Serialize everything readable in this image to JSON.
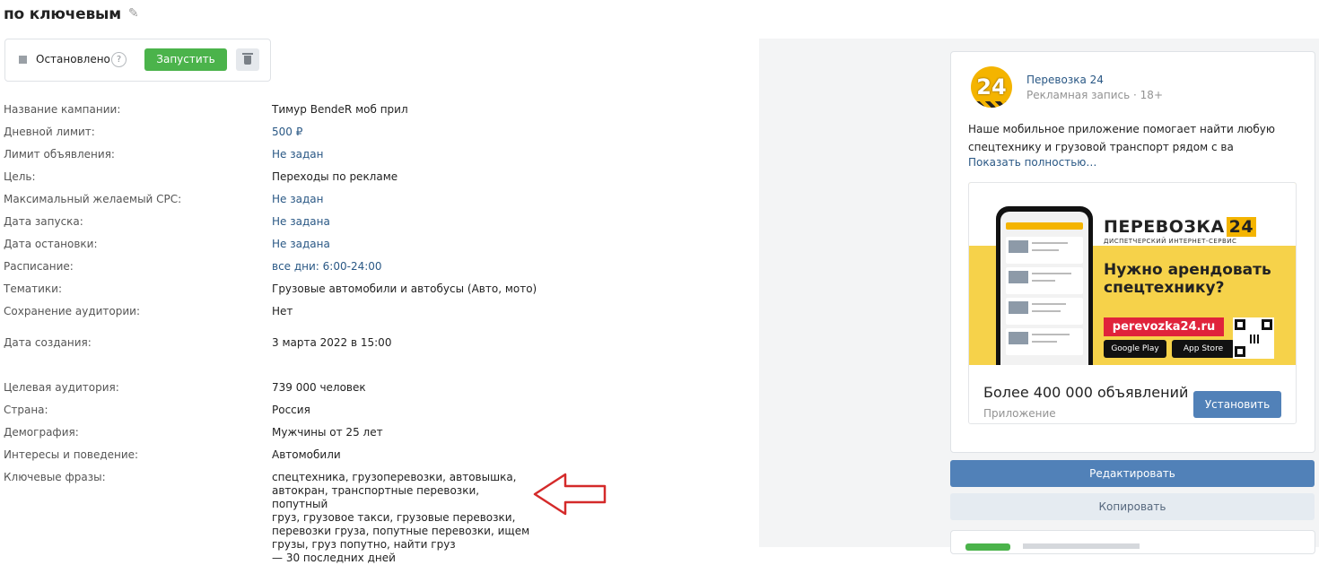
{
  "page": {
    "title": "по ключевым"
  },
  "status": {
    "text": "Остановлено",
    "help": "?",
    "run_label": "Запустить"
  },
  "fields": [
    {
      "label": "Название кампании:",
      "value": "Тимур BendeR моб прил",
      "link": false
    },
    {
      "label": "Дневной лимит:",
      "value": "500 ₽",
      "link": true
    },
    {
      "label": "Лимит объявления:",
      "value": "Не задан",
      "link": true
    },
    {
      "label": "Цель:",
      "value": "Переходы по рекламе",
      "link": false
    },
    {
      "label": "Максимальный желаемый CPC:",
      "value": "Не задан",
      "link": true
    },
    {
      "label": "Дата запуска:",
      "value": "Не задана",
      "link": true
    },
    {
      "label": "Дата остановки:",
      "value": "Не задана",
      "link": true
    },
    {
      "label": "Расписание:",
      "value": "все дни: 6:00-24:00",
      "link": true
    },
    {
      "label": "Тематики:",
      "value": "Грузовые автомобили и автобусы (Авто, мото)",
      "link": false
    },
    {
      "label": "Сохранение аудитории:",
      "value": "Нет",
      "link": false
    },
    {
      "label": "Дата создания:",
      "value": "3 марта 2022 в 15:00",
      "link": false
    },
    {
      "label": "Целевая аудитория:",
      "value": "739 000 человек",
      "link": false
    },
    {
      "label": "Страна:",
      "value": "Россия",
      "link": false
    },
    {
      "label": "Демография:",
      "value": "Мужчины от 25 лет",
      "link": false
    },
    {
      "label": "Интересы и поведение:",
      "value": "Автомобили",
      "link": false
    }
  ],
  "keywords": {
    "label": "Ключевые фразы:",
    "lines": [
      "спецтехника, грузоперевозки, автовышка,",
      "автокран, транспортные перевозки, попутный",
      "груз, грузовое такси, грузовые перевозки,",
      "перевозки груза, попутные перевозки, ищем",
      "грузы, груз попутно, найти груз",
      "— 30 последних дней"
    ]
  },
  "ad": {
    "name": "Перевозка 24",
    "sub": "Рекламная запись · 18+",
    "logo_text": "24",
    "text": "Наше мобильное приложение помогает найти любую спецтехнику и грузовой транспорт рядом с ва",
    "more": "Показать полностью…",
    "banner": {
      "brand": "ПЕРЕВОЗКА",
      "brand_num": "24",
      "brand_sub": "ДИСПЕТЧЕРСКИЙ ИНТЕРНЕТ-СЕРВИС",
      "promo": "Нужно арендовать спецтехнику?",
      "url": "perevozka24.ru",
      "google_play": "Google Play",
      "app_store": "App Store"
    },
    "headline": "Более 400 000 объявлений",
    "app_label": "Приложение",
    "install_label": "Установить"
  },
  "actions": {
    "edit": "Редактировать",
    "copy": "Копировать"
  },
  "colors": {
    "accent": "#5181b8",
    "run": "#4bb34b",
    "link": "#2a5885",
    "arrow": "#d42a2a"
  }
}
